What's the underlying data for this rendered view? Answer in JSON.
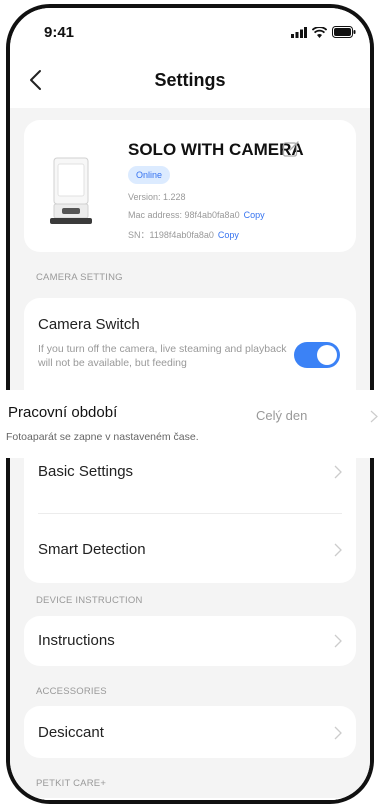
{
  "status_bar": {
    "time": "9:41"
  },
  "nav": {
    "title": "Settings"
  },
  "device": {
    "name": "SOLO WITH CAMERA",
    "status": "Online",
    "version": "Version: 1.228",
    "mac": "Mac address: 98f4ab0fa8a0",
    "sn": "SN：1198f4ab0fa8a0",
    "copy_label": "Copy"
  },
  "camera_section": {
    "label": "CAMERA SETTING",
    "switch_title": "Camera Switch",
    "switch_desc": "If you turn off the camera, live steaming and playback will not be available, but feeding",
    "switch_on": true
  },
  "working_period": {
    "title": "Pracovní období",
    "description": "Fotoaparát se zapne v nastaveném čase.",
    "value": "Celý den"
  },
  "settings": {
    "basic": "Basic Settings",
    "smart_detection": "Smart Detection"
  },
  "device_instruction": {
    "label": "DEVICE INSTRUCTION",
    "instructions": "Instructions"
  },
  "accessories": {
    "label": "ACCESSORIES",
    "desiccant": "Desiccant"
  },
  "care": {
    "label": "PETKIT CARE+"
  },
  "colors": {
    "accent": "#3673f0",
    "toggle": "#3b82f6",
    "background": "#f4f4f4"
  }
}
